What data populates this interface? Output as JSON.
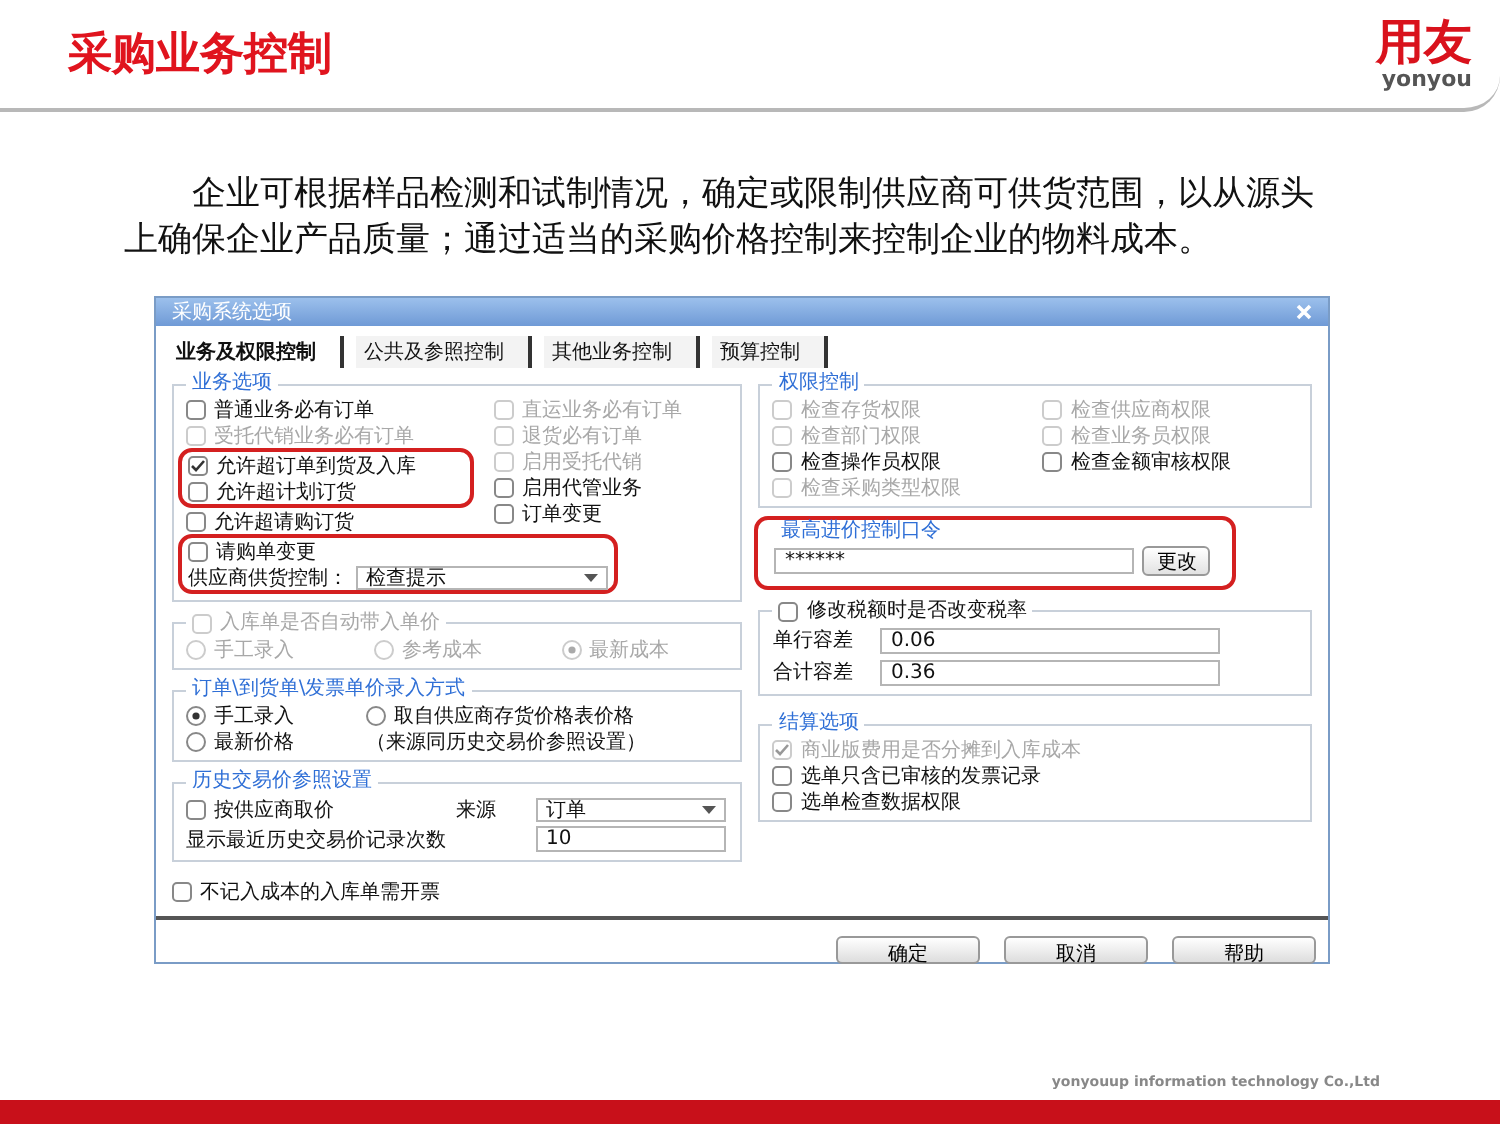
{
  "slide": {
    "title": "采购业务控制",
    "logo": {
      "brand": "用友",
      "sub": "yonyou"
    },
    "paragraph": "企业可根据样品检测和试制情况，确定或限制供应商可供货范围，以从源头上确保企业产品质量；通过适当的采购价格控制来控制企业的物料成本。",
    "footer_text": "yonyouup information technology Co.,Ltd"
  },
  "dialog": {
    "title": "采购系统选项",
    "tabs": [
      {
        "label": "业务及权限控制",
        "selected": true
      },
      {
        "label": "公共及参照控制",
        "selected": false
      },
      {
        "label": "其他业务控制",
        "selected": false
      },
      {
        "label": "预算控制",
        "selected": false
      }
    ],
    "business": {
      "title": "业务选项",
      "left": [
        {
          "label": "普通业务必有订单",
          "checked": false,
          "disabled": false,
          "highlighted": false
        },
        {
          "label": "受托代销业务必有订单",
          "checked": false,
          "disabled": true,
          "highlighted": false
        },
        {
          "label": "允许超订单到货及入库",
          "checked": true,
          "disabled": false,
          "highlighted": true
        },
        {
          "label": "允许超计划订货",
          "checked": false,
          "disabled": false,
          "highlighted": true
        },
        {
          "label": "允许超请购订货",
          "checked": false,
          "disabled": false,
          "highlighted": false
        }
      ],
      "right": [
        {
          "label": "直运业务必有订单",
          "checked": false,
          "disabled": true
        },
        {
          "label": "退货必有订单",
          "checked": false,
          "disabled": true
        },
        {
          "label": "启用受托代销",
          "checked": false,
          "disabled": true
        },
        {
          "label": "启用代管业务",
          "checked": false,
          "disabled": false
        },
        {
          "label": "订单变更",
          "checked": false,
          "disabled": false
        }
      ],
      "extra": {
        "highlighted": true,
        "checkbox": {
          "label": "请购单变更",
          "checked": false
        },
        "select": {
          "label": "供应商供货控制：",
          "value": "检查提示"
        }
      }
    },
    "auto_price": {
      "title": "入库单是否自动带入单价",
      "checked": false,
      "disabled": true,
      "options": [
        {
          "label": "手工录入",
          "selected": false
        },
        {
          "label": "参考成本",
          "selected": false
        },
        {
          "label": "最新成本",
          "selected": true
        }
      ]
    },
    "price_entry": {
      "title": "订单\\到货单\\发票单价录入方式",
      "options": [
        {
          "label": "手工录入",
          "selected": true
        },
        {
          "label": "取自供应商存货价格表价格",
          "selected": false
        },
        {
          "label": "最新价格",
          "selected": false
        }
      ],
      "note": "（来源同历史交易价参照设置）"
    },
    "history": {
      "title": "历史交易价参照设置",
      "by_supplier": {
        "label": "按供应商取价",
        "checked": false
      },
      "source_label": "来源",
      "source_value": "订单",
      "count_label": "显示最近历史交易价记录次数",
      "count_value": "10"
    },
    "invoice_option": {
      "label": "不记入成本的入库单需开票",
      "checked": false
    },
    "permissions": {
      "title": "权限控制",
      "items": [
        {
          "label": "检查存货权限",
          "checked": false,
          "disabled": true
        },
        {
          "label": "检查供应商权限",
          "checked": false,
          "disabled": true
        },
        {
          "label": "检查部门权限",
          "checked": false,
          "disabled": true
        },
        {
          "label": "检查业务员权限",
          "checked": false,
          "disabled": true
        },
        {
          "label": "检查操作员权限",
          "checked": false,
          "disabled": false
        },
        {
          "label": "检查金额审核权限",
          "checked": false,
          "disabled": false
        },
        {
          "label": "检查采购类型权限",
          "checked": false,
          "disabled": true
        }
      ]
    },
    "password": {
      "title": "最高进价控制口令",
      "value": "******",
      "button": "更改",
      "highlighted": true
    },
    "tax": {
      "title": "修改税额时是否改变税率",
      "checked": false,
      "fields": [
        {
          "label": "单行容差",
          "value": "0.06"
        },
        {
          "label": "合计容差",
          "value": "0.36"
        }
      ]
    },
    "settlement": {
      "title": "结算选项",
      "items": [
        {
          "label": "商业版费用是否分摊到入库成本",
          "checked": true,
          "disabled": true
        },
        {
          "label": "选单只含已审核的发票记录",
          "checked": false,
          "disabled": false
        },
        {
          "label": "选单检查数据权限",
          "checked": false,
          "disabled": false
        }
      ]
    },
    "buttons": [
      "确定",
      "取消",
      "帮助"
    ]
  }
}
